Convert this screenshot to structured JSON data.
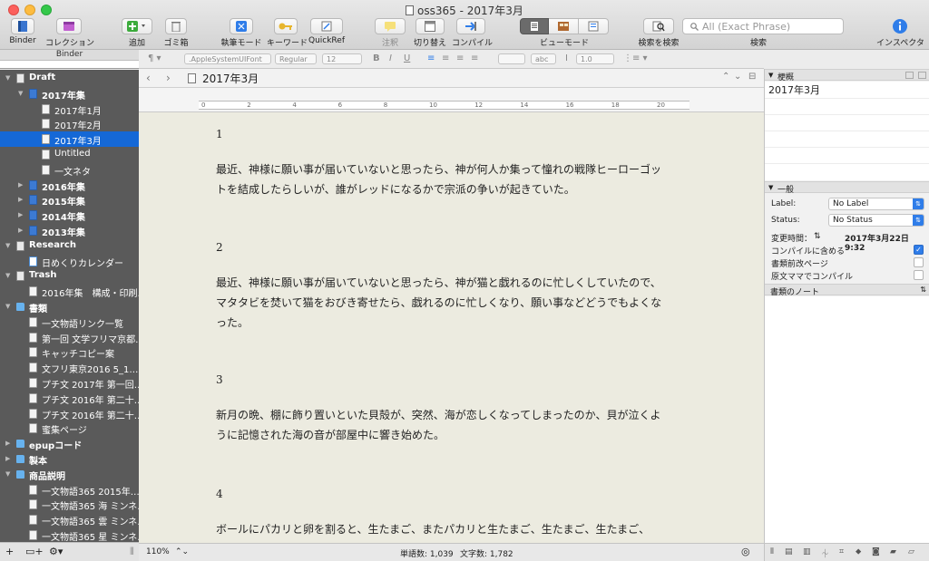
{
  "window": {
    "title": "oss365 - 2017年3月"
  },
  "toolbar": {
    "binder": "Binder",
    "collection": "コレクション",
    "add": "追加",
    "trash": "ゴミ箱",
    "compose_mode": "執筆モード",
    "keyword": "キーワード",
    "quickref": "QuickRef",
    "annotation": "注釈",
    "split": "切り替え",
    "compile": "コンパイル",
    "view_mode": "ビューモード",
    "search_document": "検索を検索",
    "search_placeholder": "All (Exact Phrase)",
    "search_label": "検索",
    "inspector": "インスペクタ"
  },
  "binder": {
    "header": "Binder",
    "items": [
      {
        "label": "Draft",
        "bold": true,
        "level": 0,
        "icon": "draft"
      },
      {
        "label": "2017年集",
        "bold": true,
        "level": 1,
        "icon": "blue"
      },
      {
        "label": "2017年1月",
        "bold": false,
        "level": 2,
        "icon": "page"
      },
      {
        "label": "2017年2月",
        "bold": false,
        "level": 2,
        "icon": "page"
      },
      {
        "label": "2017年3月",
        "bold": false,
        "level": 2,
        "icon": "page",
        "selected": true
      },
      {
        "label": "Untitled",
        "bold": false,
        "level": 2,
        "icon": "page"
      },
      {
        "label": "一文ネタ",
        "bold": false,
        "level": 2,
        "icon": "page"
      },
      {
        "label": "2016年集",
        "bold": true,
        "level": 1,
        "icon": "blue"
      },
      {
        "label": "2015年集",
        "bold": true,
        "level": 1,
        "icon": "blue"
      },
      {
        "label": "2014年集",
        "bold": true,
        "level": 1,
        "icon": "blue"
      },
      {
        "label": "2013年集",
        "bold": true,
        "level": 1,
        "icon": "blue"
      },
      {
        "label": "Research",
        "bold": true,
        "level": 0,
        "icon": "draft"
      },
      {
        "label": "日めくりカレンダー",
        "bold": false,
        "level": 1,
        "icon": "cal"
      },
      {
        "label": "Trash",
        "bold": true,
        "level": 0,
        "icon": "draft"
      },
      {
        "label": "2016年集　構成・印刷…",
        "bold": false,
        "level": 1,
        "icon": "page"
      },
      {
        "label": "書類",
        "bold": true,
        "level": 0,
        "icon": "folder"
      },
      {
        "label": "一文物語リンク一覧",
        "bold": false,
        "level": 1,
        "icon": "page"
      },
      {
        "label": "第一回 文学フリマ京都…",
        "bold": false,
        "level": 1,
        "icon": "page"
      },
      {
        "label": "キャッチコピー案",
        "bold": false,
        "level": 1,
        "icon": "page"
      },
      {
        "label": "文フリ東京2016 5_1…",
        "bold": false,
        "level": 1,
        "icon": "page"
      },
      {
        "label": "プチ文 2017年 第一回…",
        "bold": false,
        "level": 1,
        "icon": "page"
      },
      {
        "label": "プチ文 2016年 第二十…",
        "bold": false,
        "level": 1,
        "icon": "page"
      },
      {
        "label": "プチ文 2016年 第二十…",
        "bold": false,
        "level": 1,
        "icon": "page"
      },
      {
        "label": "蜜集ページ",
        "bold": false,
        "level": 1,
        "icon": "page"
      },
      {
        "label": "epupコード",
        "bold": true,
        "level": 0,
        "icon": "folder"
      },
      {
        "label": "製本",
        "bold": true,
        "level": 0,
        "icon": "folder"
      },
      {
        "label": "商品説明",
        "bold": true,
        "level": 0,
        "icon": "folder"
      },
      {
        "label": "一文物語365 2015年…",
        "bold": false,
        "level": 1,
        "icon": "page"
      },
      {
        "label": "一文物語365 海 ミンネ…",
        "bold": false,
        "level": 1,
        "icon": "page"
      },
      {
        "label": "一文物語365 雲 ミンネ…",
        "bold": false,
        "level": 1,
        "icon": "page"
      },
      {
        "label": "一文物語365 星 ミンネ…",
        "bold": false,
        "level": 1,
        "icon": "page"
      }
    ]
  },
  "formatbar": {
    "font": ".AppleSystemUIFont",
    "style": "Regular",
    "size": "12",
    "bold": "B",
    "italic": "I",
    "underline": "U",
    "highlight": "abc",
    "line_spacing": "1.0"
  },
  "editor": {
    "title": "2017年3月",
    "ruler_numbers": [
      "0",
      "2",
      "4",
      "6",
      "8",
      "10",
      "12",
      "14",
      "16",
      "18",
      "20"
    ],
    "paragraphs": [
      {
        "num": "1",
        "text": "最近、神様に願い事が届いていないと思ったら、神が何人か集って憧れの戦隊ヒーローゴットを結成したらしいが、誰がレッドになるかで宗派の争いが起きていた。"
      },
      {
        "num": "2",
        "text": "最近、神様に願い事が届いていないと思ったら、神が猫と戯れるのに忙しくしていたので、マタタビを焚いて猫をおびき寄せたら、戯れるのに忙しくなり、願い事などどうでもよくなった。"
      },
      {
        "num": "3",
        "text": "新月の晩、棚に飾り置いといた貝殻が、突然、海が恋しくなってしまったのか、貝が泣くように記憶された海の音が部屋中に響き始めた。"
      },
      {
        "num": "4",
        "text": "ボールにパカリと卵を割ると、生たまご、またパカリと生たまご、生たまご、生たまご、"
      }
    ]
  },
  "statusbar": {
    "zoom": "110%",
    "word_count": "単語数: 1,039",
    "char_count": "文字数: 1,782"
  },
  "inspector": {
    "synopsis_header": "梗概",
    "synopsis_text": "2017年3月",
    "general_header": "一般",
    "label_field": "Label:",
    "label_value": "No Label",
    "status_field": "Status:",
    "status_value": "No Status",
    "modified_label": "変更時間：",
    "modified_value": "2017年3月22日 9:32",
    "include_compile": "コンパイルに含める",
    "page_break": "書類前改ページ",
    "compile_as_is": "原文ママでコンパイル",
    "include_compile_checked": true,
    "page_break_checked": false,
    "compile_as_is_checked": false,
    "notes_header": "書類のノート"
  }
}
